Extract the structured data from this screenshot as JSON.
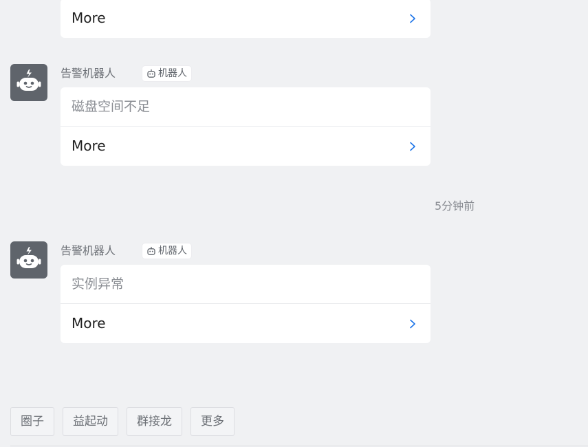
{
  "colors": {
    "background": "#f0f1f3",
    "card": "#ffffff",
    "avatar": "#5f646b",
    "chevron": "#1a73e8",
    "muted_text": "#8a8d93",
    "primary_text": "#222222"
  },
  "messages": [
    {
      "more_label": "More",
      "more_icon": "chevron-right-icon"
    },
    {
      "sender": "告警机器人",
      "tag": "机器人",
      "tag_icon": "robot-icon",
      "avatar_icon": "robot-avatar-icon",
      "body": "磁盘空间不足",
      "more_label": "More",
      "more_icon": "chevron-right-icon"
    },
    {
      "sender": "告警机器人",
      "tag": "机器人",
      "tag_icon": "robot-icon",
      "avatar_icon": "robot-avatar-icon",
      "body": "实例异常",
      "more_label": "More",
      "more_icon": "chevron-right-icon"
    }
  ],
  "timestamp": "5分钟前",
  "quick_actions": [
    {
      "label": "圈子"
    },
    {
      "label": "益起动"
    },
    {
      "label": "群接龙"
    },
    {
      "label": "更多"
    }
  ]
}
